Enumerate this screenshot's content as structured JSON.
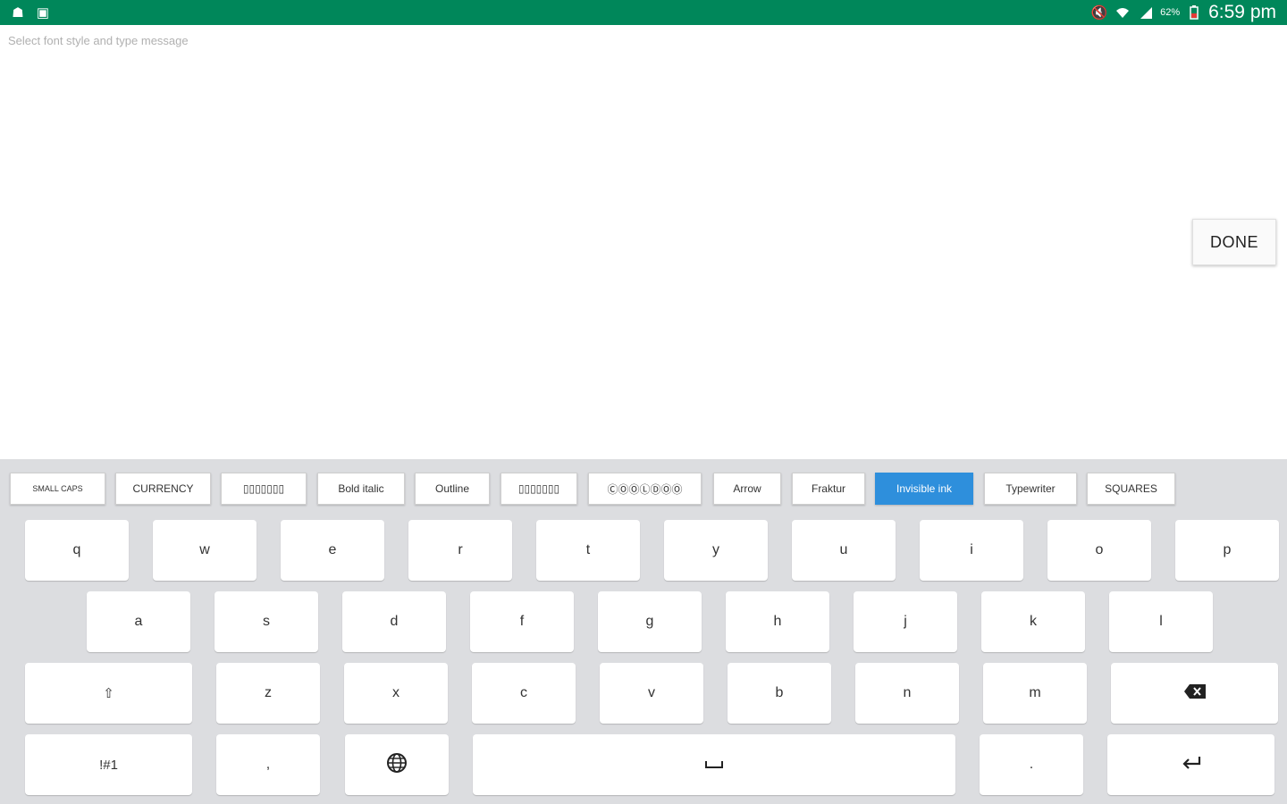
{
  "status_bar": {
    "left_icons": [
      "notification-app-icon",
      "gallery-icon"
    ],
    "right_icons": [
      "mute-icon",
      "wifi-icon",
      "signal-icon"
    ],
    "battery": "62%",
    "time": "6:59 pm",
    "bg_color": "#00875a"
  },
  "message": {
    "placeholder": "Select font style and type message",
    "done_label": "DONE"
  },
  "font_styles": {
    "active_color": "#2e8fdc",
    "items": [
      {
        "label": "SMALL CAPS"
      },
      {
        "label": "CURRENCY"
      },
      {
        "label": "▯▯▯▯▯▯▯"
      },
      {
        "label": "Bold italic"
      },
      {
        "label": "Outline"
      },
      {
        "label": "▯▯▯▯▯▯▯"
      },
      {
        "label": "ⒸⓄⓄⓁⒹⓄⓄ"
      },
      {
        "label": "Arrow"
      },
      {
        "label": "Fraktur"
      },
      {
        "label": "Invisible ink",
        "active": true
      },
      {
        "label": "Typewriter"
      },
      {
        "label": "SQUARES"
      }
    ]
  },
  "keyboard": {
    "row1": [
      "q",
      "w",
      "e",
      "r",
      "t",
      "y",
      "u",
      "i",
      "o",
      "p"
    ],
    "row2": [
      "a",
      "s",
      "d",
      "f",
      "g",
      "h",
      "j",
      "k",
      "l"
    ],
    "row3": [
      "z",
      "x",
      "c",
      "v",
      "b",
      "n",
      "m"
    ],
    "symbols_label": "!#1",
    "comma": ",",
    "period": "."
  }
}
